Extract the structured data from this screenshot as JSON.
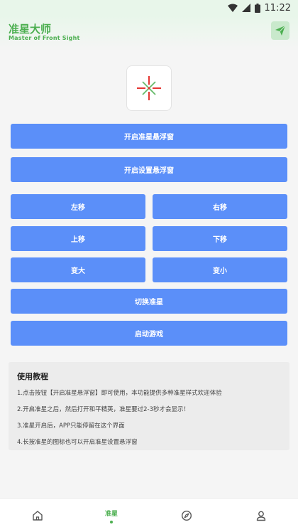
{
  "status_bar": {
    "time": "11:22"
  },
  "header": {
    "title": "准星大师",
    "subtitle": "Master of Front Sight"
  },
  "buttons": {
    "open_crosshair": "开启准星悬浮窗",
    "open_settings": "开启设置悬浮窗",
    "move_left": "左移",
    "move_right": "右移",
    "move_up": "上移",
    "move_down": "下移",
    "enlarge": "变大",
    "shrink": "变小",
    "switch_crosshair": "切换准星",
    "launch_game": "启动游戏"
  },
  "tutorial": {
    "title": "使用教程",
    "items": [
      "1.点击按钮【开启准星悬浮窗】即可使用，本功能提供多种准星样式欢迎体验",
      "2.开启准星之后，然后打开和平精英，准星要过2-3秒才会显示！",
      "3.准星开启后，APP只能停留在这个界面",
      "4.长按准星的图标也可以开启准星设置悬浮窗"
    ]
  },
  "nav": {
    "active_label": "准星"
  },
  "colors": {
    "accent": "#4caf50",
    "button": "#5b8ff9"
  }
}
